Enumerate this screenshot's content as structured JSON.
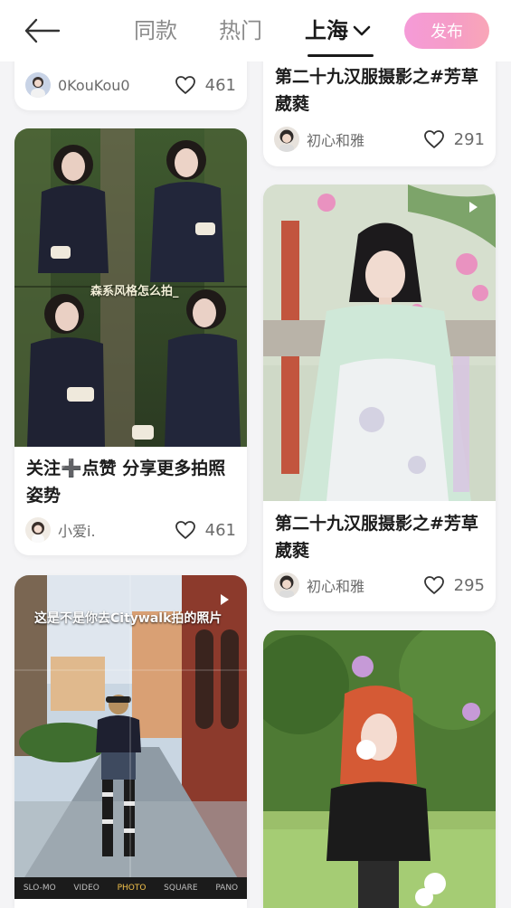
{
  "header": {
    "tabs": {
      "same": "同款",
      "hot": "热门",
      "city": "上海"
    },
    "publish_label": "发布"
  },
  "feed": {
    "col_left": {
      "card_top": {
        "author": "0KouKou0",
        "likes": "461"
      },
      "card_forest": {
        "overlay": "森系风格怎么拍_",
        "title": "关注➕点赞 分享更多拍照姿势",
        "author": "小爱i.",
        "likes": "461"
      },
      "card_street": {
        "overlay": "这是不是你去Citywalk拍的照片",
        "camera_modes": [
          "SLO-MO",
          "VIDEO",
          "PHOTO",
          "SQUARE",
          "PANO"
        ]
      }
    },
    "col_right": {
      "card_top": {
        "title": "第二十九汉服摄影之#芳草葳蕤",
        "author": "初心和雅",
        "likes": "291"
      },
      "card_hanfu": {
        "title": "第二十九汉服摄影之#芳草葳蕤",
        "author": "初心和雅",
        "likes": "295"
      }
    }
  },
  "colors": {
    "accent_gradient_start": "#f59bd8",
    "accent_gradient_end": "#f9a6b7",
    "tab_active": "#1a1a1a"
  },
  "icons": [
    "back-arrow-icon",
    "chevron-down-icon",
    "heart-icon",
    "play-icon"
  ]
}
